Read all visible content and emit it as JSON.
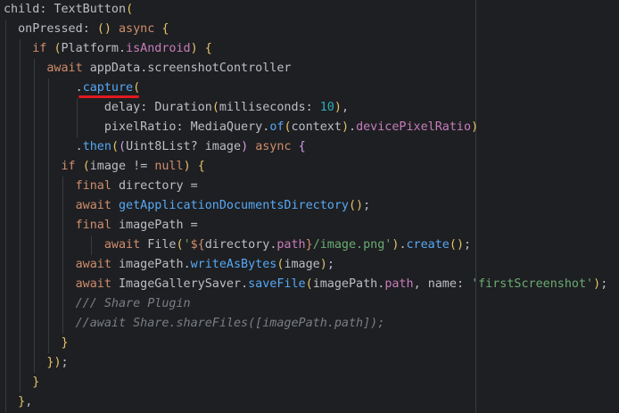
{
  "lines": [
    "child: TextButton(",
    "  onPressed: () async {",
    "    if (Platform.isAndroid) {",
    "      await appData.screenshotController",
    "          .capture(",
    "              delay: Duration(milliseconds: 10),",
    "              pixelRatio: MediaQuery.of(context).devicePixelRatio)",
    "          .then((Uint8List? image) async {",
    "        if (image != null) {",
    "          final directory =",
    "          await getApplicationDocumentsDirectory();",
    "          final imagePath =",
    "              await File('${directory.path}/image.png').create();",
    "          await imagePath.writeAsBytes(image);",
    "          await ImageGallerySaver.saveFile(imagePath.path, name: 'firstScreenshot');",
    "          /// Share Plugin",
    "          //await Share.shareFiles([imagePath.path]);",
    "        }",
    "      });",
    "    }",
    "  },"
  ],
  "colors": {
    "background": "#1e1f22",
    "keyword": "#cf8e6d",
    "function": "#56a8f5",
    "string": "#6aab73",
    "number": "#2aacb8",
    "comment": "#7a7e85",
    "highlight": "#e0191e"
  }
}
